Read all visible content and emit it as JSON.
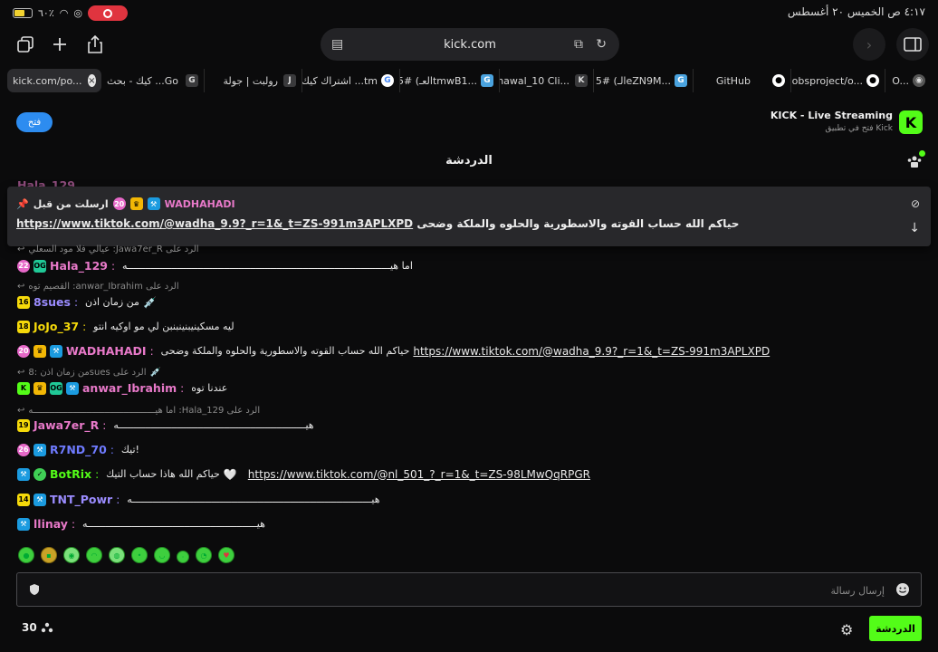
{
  "status_bar": {
    "battery_percent": "٦٠٪",
    "battery_level": 0.6,
    "time_date": "٤:١٧ ص   الخميس ٢٠ أغسطس"
  },
  "toolbar": {
    "address": "kick.com"
  },
  "tabs": [
    {
      "label": "kick.com/po...",
      "favicon": "kick-favicon",
      "active": true
    },
    {
      "label": "كيك - بحث ...Go",
      "favicon": "google-favicon",
      "fav_letter": "G",
      "active": false
    },
    {
      "label": "رولبت | جولة",
      "favicon": "j-favicon",
      "fav_letter": "J",
      "active": false
    },
    {
      "label": "اشتراك كيك ...tm",
      "favicon": "google-color-favicon",
      "active": false
    },
    {
      "label": "العـ) #5tmwB1...",
      "favicon": "g-blue-favicon",
      "fav_letter": "G",
      "active": false
    },
    {
      "label": "nawal_10 Cli...",
      "favicon": "k-favicon",
      "fav_letter": "K",
      "active": false
    },
    {
      "label": "الـ) #5eZN9M...",
      "favicon": "g-blue-favicon",
      "fav_letter": "G",
      "active": false
    },
    {
      "label": "GitHub",
      "favicon": "github-favicon",
      "active": false
    },
    {
      "label": "obsproject/o...",
      "favicon": "github-favicon",
      "active": false
    },
    {
      "label": "O...",
      "favicon": "obs-favicon",
      "active": false
    }
  ],
  "banner": {
    "open_label": "فتح",
    "title": "KICK - Live Streaming",
    "subtitle": "فتح في تطبيق Kick",
    "logo_letter": "K"
  },
  "chat": {
    "title": "الدردشة",
    "pinned": {
      "sent_by_label": "ارسلت من قبل",
      "username": "WADHAHADI",
      "badge_count": "20",
      "link": "https://www.tiktok.com/@wadha_9.9?_r=1&_t=ZS-991m3APLXPD",
      "text": "حياكم الله حساب القوته والاسطورية والحلوه والملكة وضحى"
    },
    "behind_pinned": {
      "username": "Hala_129",
      "reply_text": "عيالي فلا مود السعلي :Jawa7er_R الرد على"
    },
    "messages": [
      {
        "username": "Hala_129",
        "color": "#e879c9",
        "badge": "22",
        "text": "اما هيــــــــــــــــــــــــــــــــــــــــــــــــــــــــــــــــــــــــــــــــــــــــــه"
      },
      {
        "reply": "القصيم توه :anwar_Ibrahim الرد على",
        "username": "8sues",
        "color": "#9b8cff",
        "badge": "16",
        "text": "من زمان اذن"
      },
      {
        "username": "JoJo_37",
        "color": "#f5d90a",
        "badge": "18",
        "text": "ليه مسكينيبنينبنبن لي مو اوكيه انتو"
      },
      {
        "username": "WADHAHADI",
        "color": "#e879c9",
        "badge": "20",
        "text": "حياكم الله حساب القوته والاسطورية والحلوه والملكة وضحى",
        "link": "https://www.tiktok.com/@wadha_9.9?_r=1&_t=ZS-991m3APLXPD"
      },
      {
        "reply": "من زمان اذن :8sues الرد على",
        "username": "anwar_Ibrahim",
        "color": "#e879c9",
        "text": "عندنا توه"
      },
      {
        "reply": "اما هيــــــــــــــــــــــــــــــــــــــــــــــه :Hala_129 الرد على",
        "username": "Jawa7er_R",
        "color": "#e879c9",
        "badge": "19",
        "text": "هيــــــــــــــــــــــــــــــــــــــــــــــــــــــــــــــــه"
      },
      {
        "username": "R7ND_70",
        "color": "#6f7bff",
        "badge": "26",
        "text": "تيك!"
      },
      {
        "username": "BotRix",
        "color": "#53fc18",
        "text": "حياكم الله هاذا حساب التيك",
        "link": "https://www.tiktok.com/@nl_501_?_r=1&_t=ZS-98LMwQqRPGR"
      },
      {
        "username": "TNT_Powr",
        "color": "#9b8cff",
        "badge": "14",
        "text": "هيــــــــــــــــــــــــــــــــــــــــــــــــــــــــــــــــــــــــــــــــــه"
      },
      {
        "username": "llinay",
        "color": "#e879c9",
        "text": "هيــــــــــــــــــــــــــــــــــــــــــــــــــــــــــه"
      }
    ],
    "input_placeholder": "إرسال رسالة",
    "viewer_count": "30",
    "chat_button_label": "الدردشة"
  },
  "colors": {
    "kick_green": "#53fc18",
    "background": "#0b0b0c",
    "open_button_blue": "#2d8cf0",
    "record_red": "#e0343f"
  }
}
